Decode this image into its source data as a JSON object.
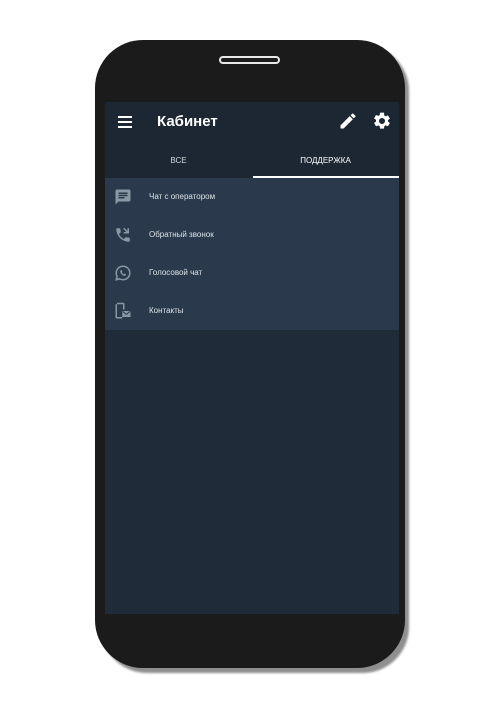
{
  "appbar": {
    "title": "Кабинет",
    "icons": [
      "menu-icon",
      "edit-icon",
      "settings-gear-icon"
    ]
  },
  "tabs": [
    {
      "label": "ВСЕ",
      "active": false
    },
    {
      "label": "ПОДДЕРЖКА",
      "active": true
    }
  ],
  "support_items": [
    {
      "label": "Чат с оператором",
      "icon": "chat-message-icon"
    },
    {
      "label": "Обратный звонок",
      "icon": "phone-callback-icon"
    },
    {
      "label": "Голосовой чат",
      "icon": "voice-chat-icon"
    },
    {
      "label": "Контакты",
      "icon": "contacts-phone-mail-icon"
    }
  ],
  "colors": {
    "appbar": "#1c2733",
    "screen": "#1f2b38",
    "list": "#2a3a4c",
    "icon": "#8a97a4",
    "accent": "#ffffff"
  }
}
